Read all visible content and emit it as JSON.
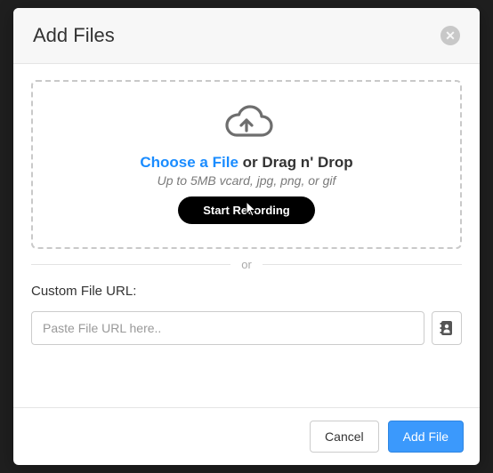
{
  "modal": {
    "title": "Add Files"
  },
  "dropzone": {
    "choose_label": "Choose a File",
    "drag_label": " or Drag n' Drop",
    "hint": "Up to 5MB vcard, jpg, png, or gif",
    "record_label": "Start Recording"
  },
  "divider": {
    "label": "or"
  },
  "url": {
    "label": "Custom File URL:",
    "placeholder": "Paste File URL here.."
  },
  "footer": {
    "cancel": "Cancel",
    "add": "Add File"
  },
  "icons": {
    "close": "close-icon",
    "cloud_upload": "cloud-upload-icon",
    "contact_card": "contact-card-icon"
  },
  "colors": {
    "primary": "#3b99fc",
    "link": "#1a8cff"
  }
}
